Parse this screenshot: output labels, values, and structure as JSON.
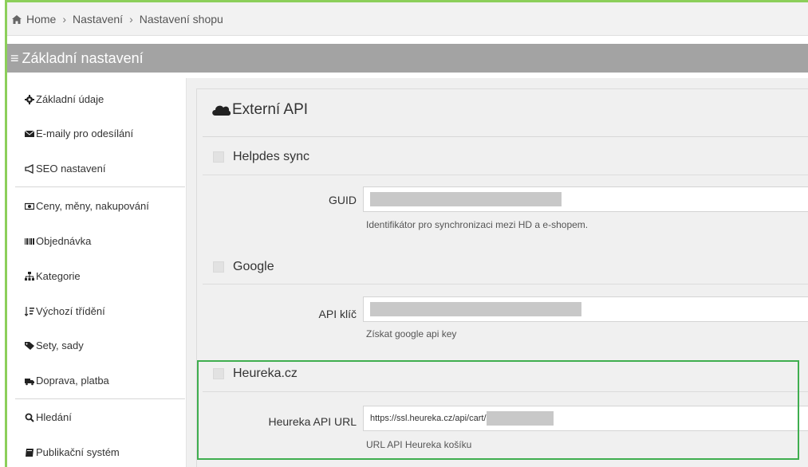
{
  "breadcrumb": {
    "home": "Home",
    "level1": "Nastavení",
    "level2": "Nastavení shopu"
  },
  "title": "Základní nastavení",
  "sidebar": {
    "items": [
      {
        "label": "Základní údaje",
        "icon": "gear-icon"
      },
      {
        "label": "E-maily pro odesílání",
        "icon": "envelope-icon"
      },
      {
        "label": "SEO nastavení",
        "icon": "bullhorn-icon"
      },
      {
        "label": "Ceny, měny, nakupování",
        "icon": "money-icon"
      },
      {
        "label": "Objednávka",
        "icon": "barcode-icon"
      },
      {
        "label": "Kategorie",
        "icon": "sitemap-icon"
      },
      {
        "label": "Výchozí třídění",
        "icon": "sort-icon"
      },
      {
        "label": "Sety, sady",
        "icon": "tags-icon"
      },
      {
        "label": "Doprava, platba",
        "icon": "truck-icon"
      },
      {
        "label": "Hledání",
        "icon": "search-icon"
      },
      {
        "label": "Publikační systém",
        "icon": "book-icon"
      }
    ]
  },
  "panel": {
    "title": "Externí API",
    "title_icon": "cloud-icon",
    "sections": {
      "helpdesk": {
        "title": "Helpdes sync",
        "field_label": "GUID",
        "help": "Identifikátor pro synchronizaci mezi HD a e-shopem."
      },
      "google": {
        "title": "Google",
        "field_label": "API klíč",
        "help": "Získat google api key"
      },
      "heureka": {
        "title": "Heureka.cz",
        "field_label": "Heureka API URL",
        "value": "https://ssl.heureka.cz/api/cart/",
        "help": "URL API Heureka košíku"
      }
    }
  },
  "colors": {
    "title_bar": "#a3a3a3",
    "highlight": "#3fae4f",
    "frame": "#8ccf5a"
  }
}
